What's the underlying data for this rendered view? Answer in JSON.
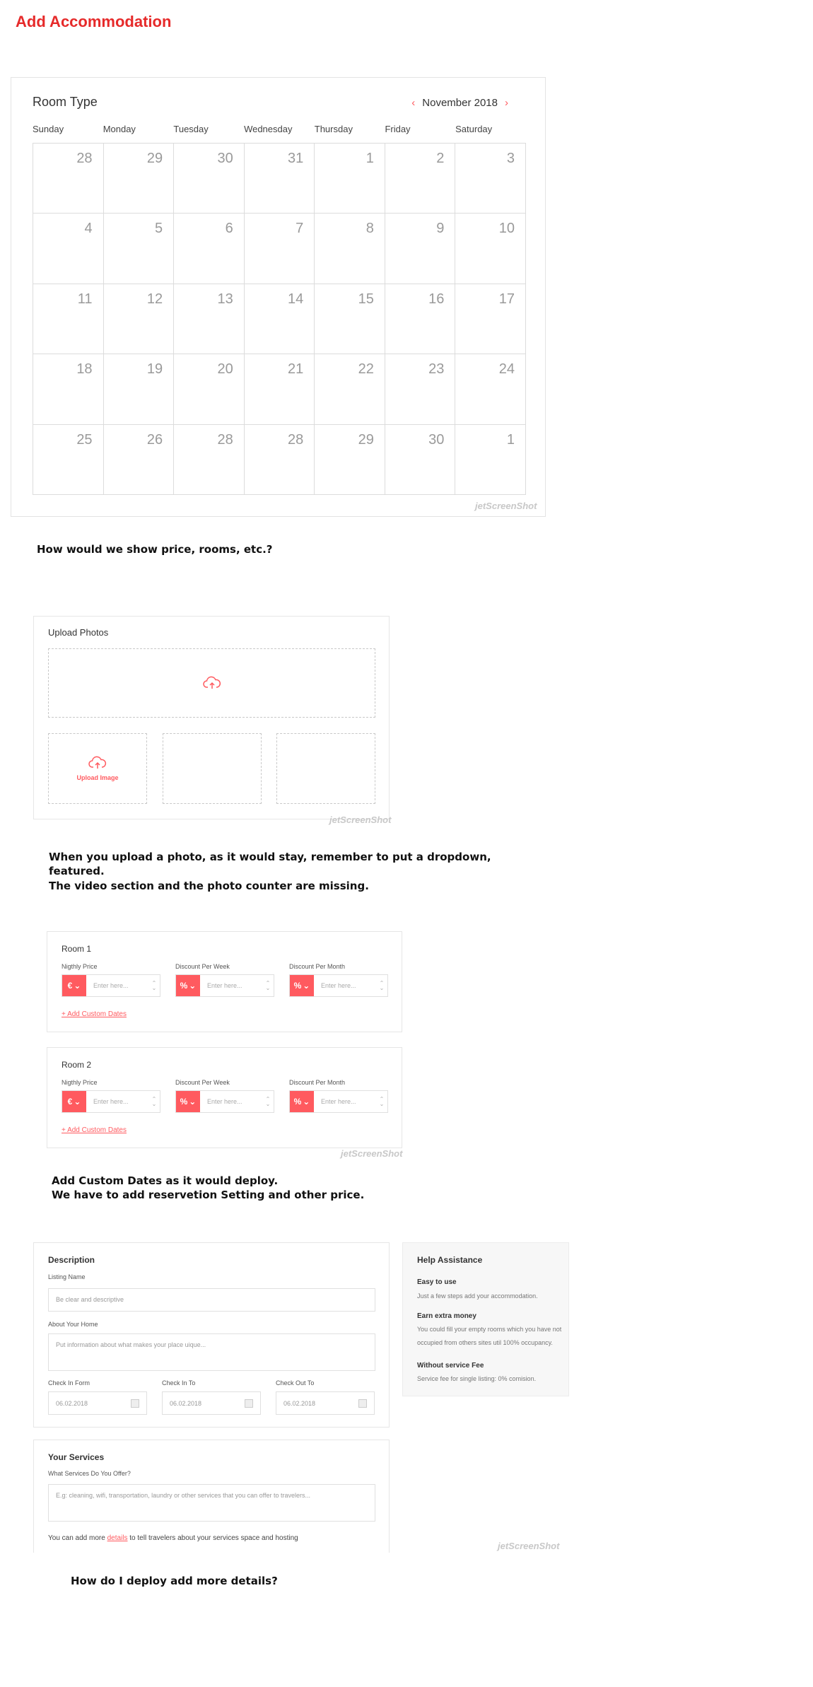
{
  "page": {
    "title": "Add Accommodation"
  },
  "calendar": {
    "title": "Room Type",
    "month": "November 2018",
    "prev_icon": "‹",
    "next_icon": "›",
    "weekdays": [
      "Sunday",
      "Monday",
      "Tuesday",
      "Wednesday",
      "Thursday",
      "Friday",
      "Saturday"
    ],
    "days": [
      "28",
      "29",
      "30",
      "31",
      "1",
      "2",
      "3",
      "4",
      "5",
      "6",
      "7",
      "8",
      "9",
      "10",
      "11",
      "12",
      "13",
      "14",
      "15",
      "16",
      "17",
      "18",
      "19",
      "20",
      "21",
      "22",
      "23",
      "24",
      "25",
      "26",
      "28",
      "28",
      "29",
      "30",
      "1"
    ]
  },
  "watermark": "jetScreenShot",
  "notes": {
    "n1": "How would we show price, rooms, etc.?",
    "n2_line1": "When you upload a photo, as it would stay, remember to put a dropdown,",
    "n2_line2": "featured.",
    "n2_line3": "The video section and the photo counter are missing.",
    "n3_line1": "Add Custom Dates as it would deploy.",
    "n3_line2": "We have to add reservetion Setting and other price.",
    "n4": "How do I deploy add more details?"
  },
  "upload": {
    "title": "Upload Photos",
    "upload_image_label": "Upload Image"
  },
  "rooms": [
    {
      "title": "Room 1",
      "nightly_label": "Nigthly Price",
      "week_label": "Discount Per Week",
      "month_label": "Discount Per Month",
      "currency_symbol": "€",
      "percent_symbol": "%",
      "placeholder": "Enter here...",
      "custom_dates": "+ Add Custom Dates"
    },
    {
      "title": "Room 2",
      "nightly_label": "Nigthly Price",
      "week_label": "Discount Per Week",
      "month_label": "Discount Per Month",
      "currency_symbol": "€",
      "percent_symbol": "%",
      "placeholder": "Enter here...",
      "custom_dates": "+ Add Custom Dates"
    }
  ],
  "description": {
    "title": "Description",
    "listing_label": "Listing Name",
    "listing_placeholder": "Be clear and descriptive",
    "about_label": "About Your Home",
    "about_placeholder": "Put information about what makes your place uique...",
    "checkin_from_label": "Check In Form",
    "checkin_to_label": "Check In To",
    "checkout_to_label": "Check Out To",
    "date_value": "06.02.2018"
  },
  "help": {
    "title": "Help Assistance",
    "items": [
      {
        "title": "Easy to use",
        "text": "Just a few steps add your accommodation."
      },
      {
        "title": "Earn extra money",
        "text": "You could fill your empty rooms which you have not occupied from others sites util 100% occupancy."
      },
      {
        "title": "Without service Fee",
        "text": "Service fee for single listing: 0% comision."
      }
    ]
  },
  "services": {
    "title": "Your Services",
    "question": "What Services Do You Offer?",
    "placeholder": "E.g: cleaning, wifi, transportation, laundry or other services that you can offer to travelers...",
    "more_prefix": "You can add more ",
    "more_link": "details",
    "more_suffix": " to tell travelers about your services space and hosting"
  },
  "colors": {
    "accent": "#ff5a5f",
    "title_red": "#e62a2a"
  }
}
